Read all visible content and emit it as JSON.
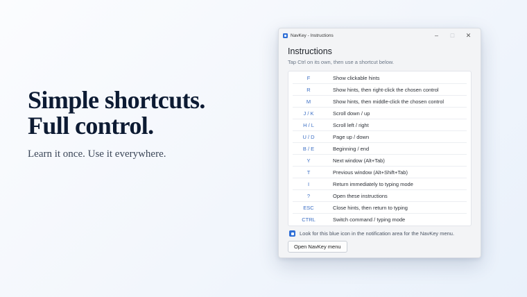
{
  "hero": {
    "title_line1": "Simple shortcuts.",
    "title_line2": "Full control.",
    "subtitle": "Learn it once. Use it everywhere."
  },
  "window": {
    "title": "NavKey - Instructions",
    "controls": {
      "minimize": "–",
      "maximize": "□",
      "close": "✕"
    },
    "icon": "navkey-app-icon",
    "accent_color": "#2f6fd6"
  },
  "instructions": {
    "heading": "Instructions",
    "subtitle": "Tap Ctrl on its own, then use a shortcut below.",
    "shortcuts": [
      {
        "key": "F",
        "desc": "Show clickable hints"
      },
      {
        "key": "R",
        "desc": "Show hints, then right-click the chosen control"
      },
      {
        "key": "M",
        "desc": "Show hints, then middle-click the chosen control"
      },
      {
        "key": "J / K",
        "desc": "Scroll down / up"
      },
      {
        "key": "H / L",
        "desc": "Scroll left / right"
      },
      {
        "key": "U / D",
        "desc": "Page up / down"
      },
      {
        "key": "B / E",
        "desc": "Beginning / end"
      },
      {
        "key": "Y",
        "desc": "Next window (Alt+Tab)"
      },
      {
        "key": "T",
        "desc": "Previous window (Alt+Shift+Tab)"
      },
      {
        "key": "I",
        "desc": "Return immediately to typing mode"
      },
      {
        "key": "?",
        "desc": "Open these instructions"
      },
      {
        "key": "ESC",
        "desc": "Close hints, then return to typing"
      },
      {
        "key": "CTRL",
        "desc": "Switch command / typing mode"
      }
    ],
    "tip": "Look for this blue icon in the notification area for the NavKey menu.",
    "open_button_label": "Open NavKey menu"
  }
}
